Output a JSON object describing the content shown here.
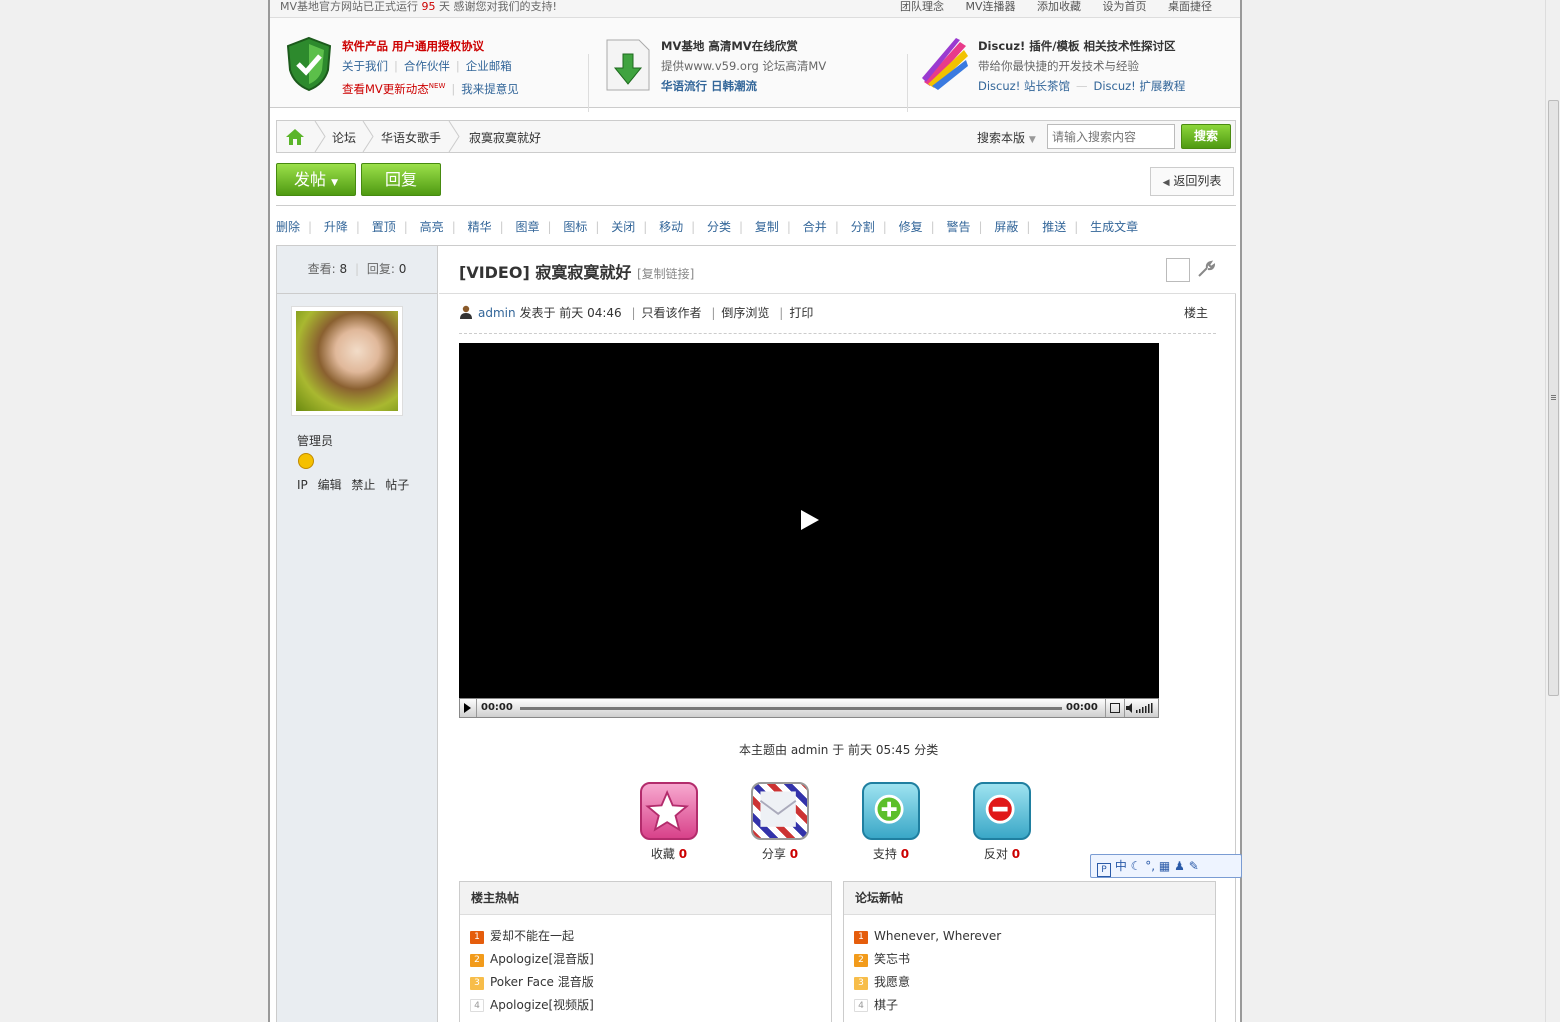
{
  "topbar": {
    "notice_pre": "MV基地官方网站已正式运行",
    "notice_days": "95",
    "notice_post": "天  感谢您对我们的支持!",
    "links": [
      "团队理念",
      "MV连播器",
      "添加收藏",
      "设为首页",
      "桌面捷径"
    ]
  },
  "promo": {
    "box1": {
      "title": "软件产品 用户通用授权协议",
      "l1": "关于我们",
      "l2": "合作伙伴",
      "l3": "企业邮箱",
      "l4": "查看MV更新动态",
      "new": "NEW",
      "l5": "我来提意见"
    },
    "box2": {
      "title": "MV基地 高清MV在线欣赏",
      "l1": "提供www.v59.org 论坛高清MV",
      "l2": "华语流行 日韩潮流"
    },
    "box3": {
      "title": "Discuz! 插件/模板 相关技术性探讨区",
      "l1": "带给你最快捷的开发技术与经验",
      "l2": "Discuz! 站长茶馆",
      "l3": "Discuz! 扩展教程"
    }
  },
  "breadcrumb": {
    "items": [
      "论坛",
      "华语女歌手",
      "寂寞寂寞就好"
    ],
    "search_scope": "搜索本版",
    "search_placeholder": "请输入搜索内容",
    "search_button": "搜索"
  },
  "actions": {
    "post": "发帖",
    "reply": "回复",
    "back": "返回列表"
  },
  "modbar": [
    "删除",
    "升降",
    "置顶",
    "高亮",
    "精华",
    "图章",
    "图标",
    "关闭",
    "移动",
    "分类",
    "复制",
    "合并",
    "分割",
    "修复",
    "警告",
    "屏蔽",
    "推送",
    "生成文章"
  ],
  "sidebar": {
    "views_label": "查看:",
    "views": "8",
    "replies_label": "回复:",
    "replies": "0",
    "role": "管理员",
    "ops": "IP 编辑 禁止 帖子"
  },
  "thread": {
    "title": "[VIDEO] 寂寞寂寞就好",
    "copy_link": "[复制链接]"
  },
  "post_meta": {
    "author": "admin",
    "posted": "发表于 前天 04:46",
    "only_author": "只看该作者",
    "reverse": "倒序浏览",
    "print": "打印",
    "floor": "楼主"
  },
  "video": {
    "time_current": "00:00",
    "time_total": "00:00"
  },
  "classify_note": "本主题由 admin 于 前天 05:45 分类",
  "reactions": [
    {
      "label": "收藏",
      "count": "0",
      "icon": "star-icon"
    },
    {
      "label": "分享",
      "count": "0",
      "icon": "envelope-icon"
    },
    {
      "label": "支持",
      "count": "0",
      "icon": "plus-icon"
    },
    {
      "label": "反对",
      "count": "0",
      "icon": "minus-icon"
    }
  ],
  "hot_posts": {
    "title": "楼主热帖",
    "items": [
      "爱却不能在一起",
      "Apologize[混音版]",
      "Poker Face 混音版",
      "Apologize[视频版]"
    ]
  },
  "new_posts": {
    "title": "论坛新帖",
    "items": [
      "Whenever, Wherever",
      "笑忘书",
      "我愿意",
      "棋子"
    ]
  },
  "ime": {
    "label": "中"
  }
}
